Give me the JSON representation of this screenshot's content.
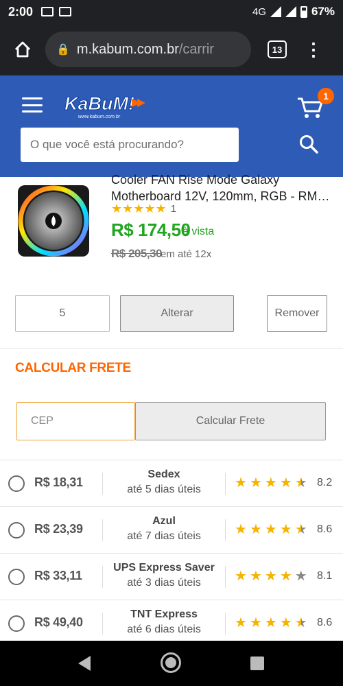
{
  "status_bar": {
    "time": "2:00",
    "network": "4G",
    "battery": "67%"
  },
  "browser": {
    "url_host": "m.kabum.com.br",
    "url_path": "/carrir",
    "tab_count": "13"
  },
  "header": {
    "logo_text": "KaBuM!",
    "logo_sub": "www.kabum.com.br",
    "search_placeholder": "O que você está procurando?",
    "cart_count": "1"
  },
  "product": {
    "title_line1": "Cooler FAN Rise Mode Galaxy",
    "title_line2": "Motherboard 12V, 120mm, RGB - RM-...",
    "rating_stars": "★★★★★",
    "rating_count": "1",
    "price": "R$ 174,50",
    "price_note": "à vista",
    "old_price": "R$ 205,30",
    "installment": "em até 12x"
  },
  "cart_actions": {
    "quantity": "5",
    "update_label": "Alterar",
    "remove_label": "Remover"
  },
  "shipping": {
    "title": "CALCULAR FRETE",
    "cep_placeholder": "CEP",
    "calc_label": "Calcular Frete",
    "options": [
      {
        "price": "R$ 18,31",
        "name": "Sedex",
        "eta": "até 5 dias úteis",
        "score": "8.2",
        "stars": 4.5
      },
      {
        "price": "R$ 23,39",
        "name": "Azul",
        "eta": "até 7 dias úteis",
        "score": "8.6",
        "stars": 4.5
      },
      {
        "price": "R$ 33,11",
        "name": "UPS Express Saver",
        "eta": "até 3 dias úteis",
        "score": "8.1",
        "stars": 4
      },
      {
        "price": "R$ 49,40",
        "name": "TNT Express",
        "eta": "até 6 dias úteis",
        "score": "8.6",
        "stars": 4.5
      }
    ]
  },
  "colors": {
    "brand_blue": "#2e5bb6",
    "accent_orange": "#ff6500",
    "price_green": "#20a520",
    "star": "#f5b400"
  }
}
